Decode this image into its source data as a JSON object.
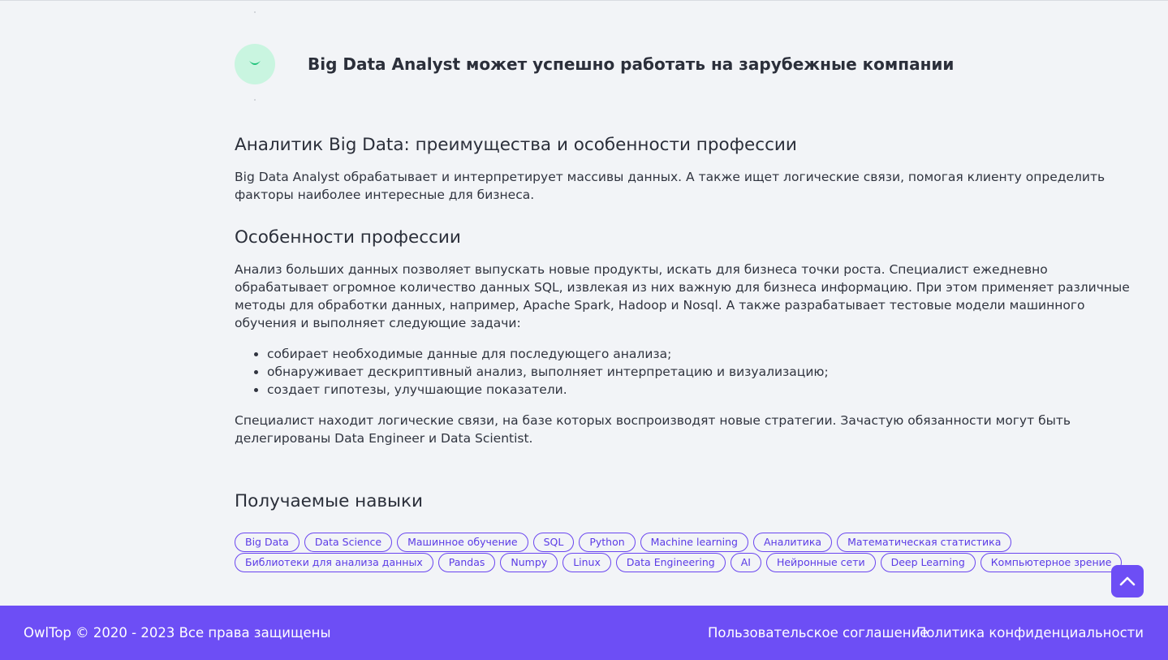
{
  "advantage": {
    "text": "Big Data Analyst может успешно работать на зарубежные компании",
    "icon": "smile-icon"
  },
  "article": {
    "heading1": "Аналитик Big Data: преимущества и особенности профессии",
    "paragraph1": "Big Data Analyst обрабатывает и интерпретирует массивы данных. А также ищет логические связи, помогая клиенту определить факторы наиболее интересные для бизнеса.",
    "heading2": "Особенности профессии",
    "paragraph2": "Анализ больших данных позволяет выпускать новые продукты, искать для бизнеса точки роста. Специалист ежедневно обрабатывает огромное количество данных SQL, извлекая из них важную для бизнеса информацию. При этом применяет различные методы для обработки данных, например, Apache Spark, Hadoop и Nosql. А также разрабатывает тестовые модели машинного обучения и выполняет следующие задачи:",
    "tasks": [
      "собирает необходимые данные для последующего анализа;",
      "обнаруживает дескриптивный анализ, выполняет интерпретацию и визуализацию;",
      "создает гипотезы, улучшающие показатели."
    ],
    "paragraph3": "Специалист находит логические связи, на базе которых воспроизводят новые стратегии. Зачастую обязанности могут быть делегированы Data Engineer и Data Scientist.",
    "heading3": "Получаемые навыки"
  },
  "skills": [
    "Big Data",
    "Data Science",
    "Машинное обучение",
    "SQL",
    "Python",
    "Machine learning",
    "Аналитика",
    "Математическая статистика",
    "Библиотеки для анализа данных",
    "Pandas",
    "Numpy",
    "Linux",
    "Data Engineering",
    "AI",
    "Нейронные сети",
    "Deep Learning",
    "Компьютерное зрение"
  ],
  "scroll_top": {
    "icon": "chevron-up-icon"
  },
  "footer": {
    "copyright": "OwlTop © 2020 - 2023 Все права защищены",
    "terms_link": "Пользовательское соглашение",
    "privacy_link": "Политика конфиденциальности"
  },
  "colors": {
    "accent": "#6d4ef5",
    "icon_bg": "#c9f5e0",
    "icon_fg": "#1fc27a",
    "page_bg": "#f2f4f7"
  }
}
